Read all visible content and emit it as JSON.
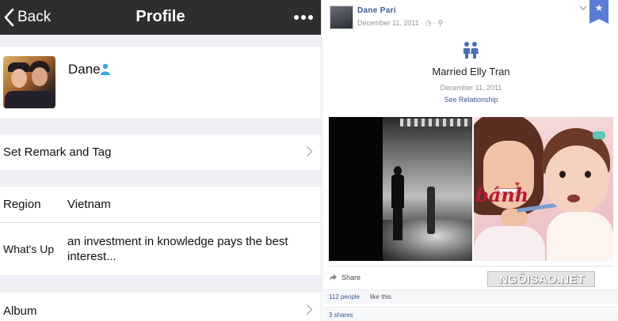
{
  "profile_screen": {
    "nav": {
      "back_label": "Back",
      "title": "Profile",
      "more_icon": "more-dots-icon"
    },
    "user": {
      "name": "Dane",
      "gender_icon": "male-person-icon",
      "gender_color": "#3aa5dc"
    },
    "remark_row": {
      "label": "Set Remark and Tag"
    },
    "region": {
      "label": "Region",
      "value": "Vietnam"
    },
    "whats_up": {
      "label": "What's Up",
      "value": "an investment in knowledge pays the best interest..."
    },
    "album_row": {
      "label": "Album"
    }
  },
  "facebook_post": {
    "poster_name": "Dane Pari",
    "date": "December 11, 2011 · ◷ · ⚲",
    "relationship": {
      "icon": "couple-icon",
      "title": "Married Elly Tran",
      "date": "December 11, 2011",
      "link": "See Relationship"
    },
    "photo_text": "bánh",
    "share_label": "Share",
    "likes": {
      "count_link": "112 people",
      "text": "like this."
    },
    "shares": "3 shares",
    "watermark": "NGÔISAO.NET",
    "accent_color": "#3b5998"
  }
}
